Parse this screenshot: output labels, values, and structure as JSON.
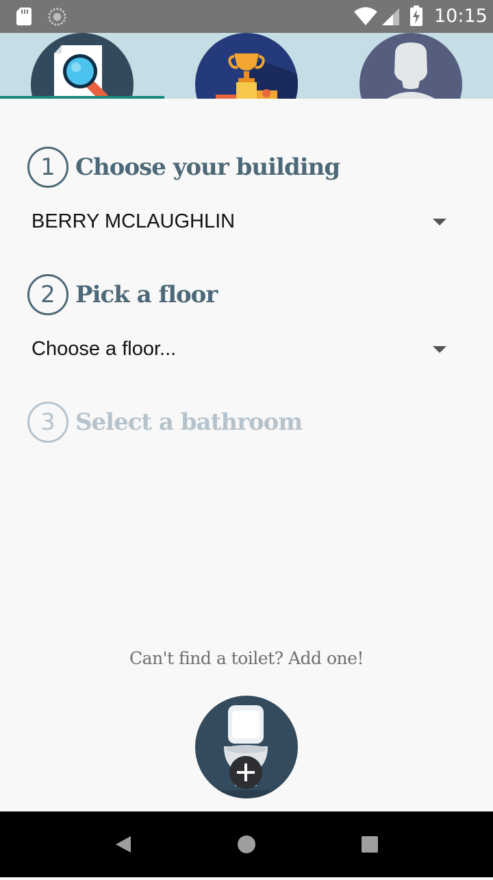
{
  "status_bar": {
    "time": "10:15",
    "icons": [
      "sd-card-icon",
      "sync-icon",
      "wifi-icon",
      "cell-signal-icon",
      "battery-charging-icon"
    ]
  },
  "tabs": [
    {
      "name": "search",
      "icon": "document-search-icon",
      "selected": true
    },
    {
      "name": "leaderboard",
      "icon": "trophy-podium-icon",
      "selected": false
    },
    {
      "name": "profile",
      "icon": "user-avatar-icon",
      "selected": false
    }
  ],
  "steps": [
    {
      "number": "1",
      "title": "Choose your building",
      "enabled": true
    },
    {
      "number": "2",
      "title": "Pick a floor",
      "enabled": true
    },
    {
      "number": "3",
      "title": "Select a bathroom",
      "enabled": false
    }
  ],
  "building_select": {
    "value": "BERRY MCLAUGHLIN"
  },
  "floor_select": {
    "value": "Choose a floor..."
  },
  "add_toilet": {
    "prompt": "Can't find a toilet? Add one!",
    "icon": "add-toilet-icon"
  },
  "colors": {
    "status_bar": "#757575",
    "tab_bar": "#c5dde4",
    "tab_indicator": "#1a8a7d",
    "step_active": "#4d6977",
    "step_disabled": "#b6c3cc",
    "background": "#f8f8f8",
    "nav_bar": "#000000"
  },
  "nav_bar": {
    "buttons": [
      "back-icon",
      "home-icon",
      "recents-icon"
    ]
  }
}
